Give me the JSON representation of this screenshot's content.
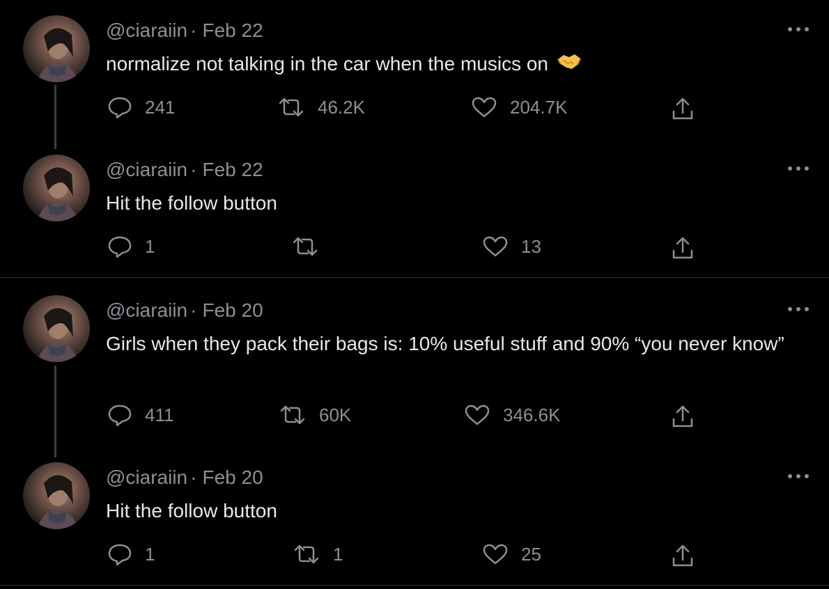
{
  "colors": {
    "background": "#000000",
    "text": "#e7e9ea",
    "secondary": "#8b9096",
    "divider": "#2f3336",
    "thread_line": "#3a3d40"
  },
  "tweets": [
    {
      "handle": "@ciaraiin",
      "separator": "·",
      "date": "Feb 22",
      "text": "normalize not talking in the car when the musics on",
      "emoji": "handshake-icon",
      "replies": "241",
      "retweets": "46.2K",
      "likes": "204.7K"
    },
    {
      "handle": "@ciaraiin",
      "separator": "·",
      "date": "Feb 22",
      "text": "Hit the follow button",
      "replies": "1",
      "retweets": "",
      "likes": "13"
    },
    {
      "handle": "@ciaraiin",
      "separator": "·",
      "date": "Feb 20",
      "text": "Girls when they pack their bags is: 10% useful stuff and 90% “you never know”",
      "replies": "411",
      "retweets": "60K",
      "likes": "346.6K"
    },
    {
      "handle": "@ciaraiin",
      "separator": "·",
      "date": "Feb 20",
      "text": "Hit the follow button",
      "replies": "1",
      "retweets": "1",
      "likes": "25"
    }
  ],
  "icons": {
    "reply": "reply-icon",
    "retweet": "retweet-icon",
    "like": "heart-icon",
    "share": "share-icon",
    "more": "more-icon"
  }
}
